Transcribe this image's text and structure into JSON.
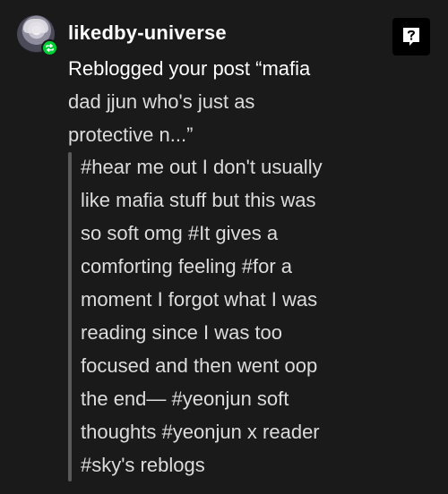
{
  "notification": {
    "username": "likedby-universe",
    "action_lines": [
      "Reblogged your post “mafia",
      "dad jjun who's just as",
      "protective n...”"
    ],
    "tag_lines": [
      "#hear me out I don't usually",
      "like mafia stuff but this was",
      "so soft omg #It gives a",
      "comforting feeling #for a",
      "moment I forgot what I was",
      "reading since I was too",
      "focused and then went oop",
      "the end— #yeonjun soft",
      "thoughts #yeonjun x reader",
      "#sky's reblogs"
    ],
    "badge_icon": "reblog-icon",
    "badge_color": "#00cf35",
    "ask_icon": "question-speech-bubble-icon"
  }
}
